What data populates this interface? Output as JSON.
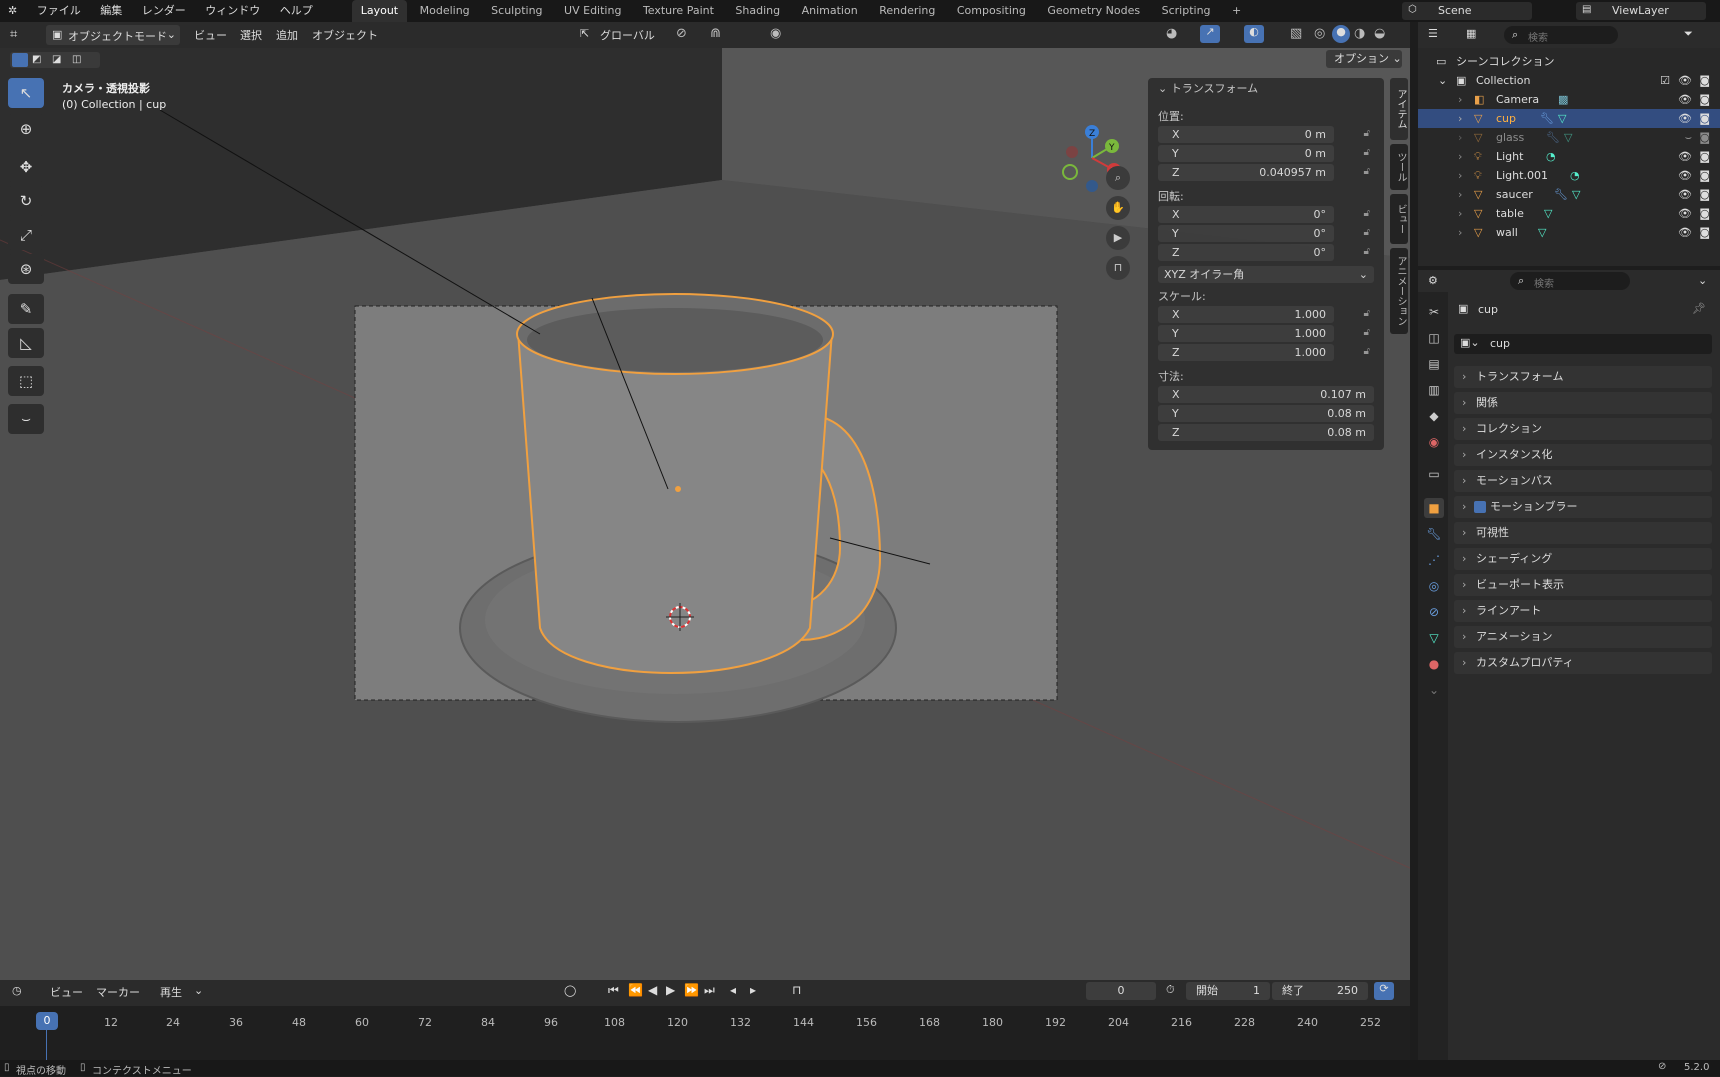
{
  "app": {
    "menu": [
      "ファイル",
      "編集",
      "レンダー",
      "ウィンドウ",
      "ヘルプ"
    ],
    "workspaces": [
      "Layout",
      "Modeling",
      "Sculpting",
      "UV Editing",
      "Texture Paint",
      "Shading",
      "Animation",
      "Rendering",
      "Compositing",
      "Geometry Nodes",
      "Scripting"
    ],
    "active_workspace": "Layout",
    "scene": "Scene",
    "view_layer": "ViewLayer",
    "version": "5.2.0"
  },
  "viewport_header": {
    "mode": "オブジェクトモード",
    "menus": [
      "ビュー",
      "選択",
      "追加",
      "オブジェクト"
    ],
    "transform_orientation": "グローバル",
    "options": "オプション"
  },
  "viewport": {
    "camera_label": "カメラ・透視投影",
    "collection_label": "(0) Collection | cup",
    "gizmo_axes": [
      "X",
      "Y",
      "Z"
    ]
  },
  "npanel": {
    "title": "トランスフォーム",
    "location_label": "位置:",
    "location": [
      {
        "axis": "X",
        "value": "0 m"
      },
      {
        "axis": "Y",
        "value": "0 m"
      },
      {
        "axis": "Z",
        "value": "0.040957 m"
      }
    ],
    "rotation_label": "回転:",
    "rotation": [
      {
        "axis": "X",
        "value": "0°"
      },
      {
        "axis": "Y",
        "value": "0°"
      },
      {
        "axis": "Z",
        "value": "0°"
      }
    ],
    "rotation_mode": "XYZ オイラー角",
    "scale_label": "スケール:",
    "scale": [
      {
        "axis": "X",
        "value": "1.000"
      },
      {
        "axis": "Y",
        "value": "1.000"
      },
      {
        "axis": "Z",
        "value": "1.000"
      }
    ],
    "dimensions_label": "寸法:",
    "dimensions": [
      {
        "axis": "X",
        "value": "0.107 m"
      },
      {
        "axis": "Y",
        "value": "0.08 m"
      },
      {
        "axis": "Z",
        "value": "0.08 m"
      }
    ],
    "tabs": [
      "アイテム",
      "ツール",
      "ビュー",
      "アニメーション"
    ]
  },
  "outliner": {
    "search_placeholder": "検索",
    "scene_collection": "シーンコレクション",
    "collection": "Collection",
    "items": [
      "Camera",
      "cup",
      "glass",
      "Light",
      "Light.001",
      "saucer",
      "table",
      "wall"
    ],
    "selected": "cup"
  },
  "properties": {
    "search_placeholder": "検索",
    "object_name": "cup",
    "datablock_name": "cup",
    "sections": [
      "トランスフォーム",
      "関係",
      "コレクション",
      "インスタンス化",
      "モーションパス",
      "モーションブラー",
      "可視性",
      "シェーディング",
      "ビューポート表示",
      "ラインアート",
      "アニメーション",
      "カスタムプロパティ"
    ]
  },
  "timeline": {
    "menus": [
      "ビュー",
      "マーカー",
      "再生"
    ],
    "current_frame": "0",
    "start_label": "開始",
    "start": "1",
    "end_label": "終了",
    "end": "250",
    "ticks": [
      "0",
      "12",
      "24",
      "36",
      "48",
      "60",
      "72",
      "84",
      "96",
      "108",
      "120",
      "132",
      "144",
      "156",
      "168",
      "180",
      "192",
      "204",
      "216",
      "228",
      "240",
      "252"
    ]
  },
  "statusbar": {
    "left1": "視点の移動",
    "left2": "コンテクストメニュー"
  }
}
